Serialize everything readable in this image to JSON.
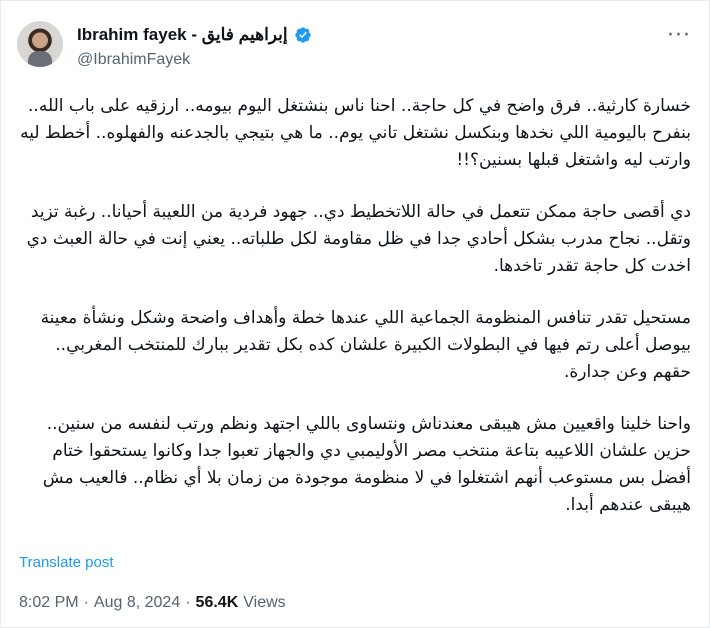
{
  "post": {
    "author": {
      "display_name": "Ibrahim fayek - إبراهيم فايق",
      "handle": "@IbrahimFayek",
      "verified_icon": "verified-badge-icon",
      "accent": "#1d9bf0"
    },
    "more_icon": "more-options-icon",
    "paragraphs": [
      "خسارة كارثية.. فرق واضح في كل حاجة.. احنا ناس بنشتغل اليوم بيومه.. ارزقيه على باب الله.. بنفرح باليومية اللي نخدها وبنكسل نشتغل تاني يوم.. ما هي بتيجي بالجدعنه والفهلوه.. أخطط ليه وارتب ليه واشتغل قبلها بسنين؟!!",
      "دي أقصى حاجة ممكن تتعمل في حالة اللاتخطيط دي.. جهود فردية من اللعيبة أحيانا.. رغبة تزيد وتقل.. نجاح مدرب بشكل أحادي جدا في ظل مقاومة لكل طلباته.. يعني إنت في حالة العبث دي اخدت كل حاجة تقدر تاخدها.",
      "مستحيل تقدر تنافس المنظومة الجماعية اللي عندها خطة وأهداف واضحة وشكل ونشأة معينة بيوصل أعلى رتم فيها في البطولات الكبيرة علشان كده بكل تقدير ببارك للمنتخب المغربي.. حقهم وعن جدارة.",
      "واحنا خلينا واقعيين مش هيبقى معندناش ونتساوى باللي اجتهد ونظم ورتب لنفسه من سنين.. حزين علشان اللاعيبه بتاعة منتخب مصر الأوليمبي دي والجهاز تعبوا جدا وكانوا يستحقوا ختام أفضل بس مستوعب أنهم اشتغلوا في لا منظومة موجودة من زمان بلا أي نظام.. فالعيب مش هيبقى عندهم أبدا."
    ],
    "translate_label": "Translate post",
    "time": "8:02 PM",
    "separator": "·",
    "date": "Aug 8, 2024",
    "views_count": "56.4K",
    "views_label": "Views"
  }
}
